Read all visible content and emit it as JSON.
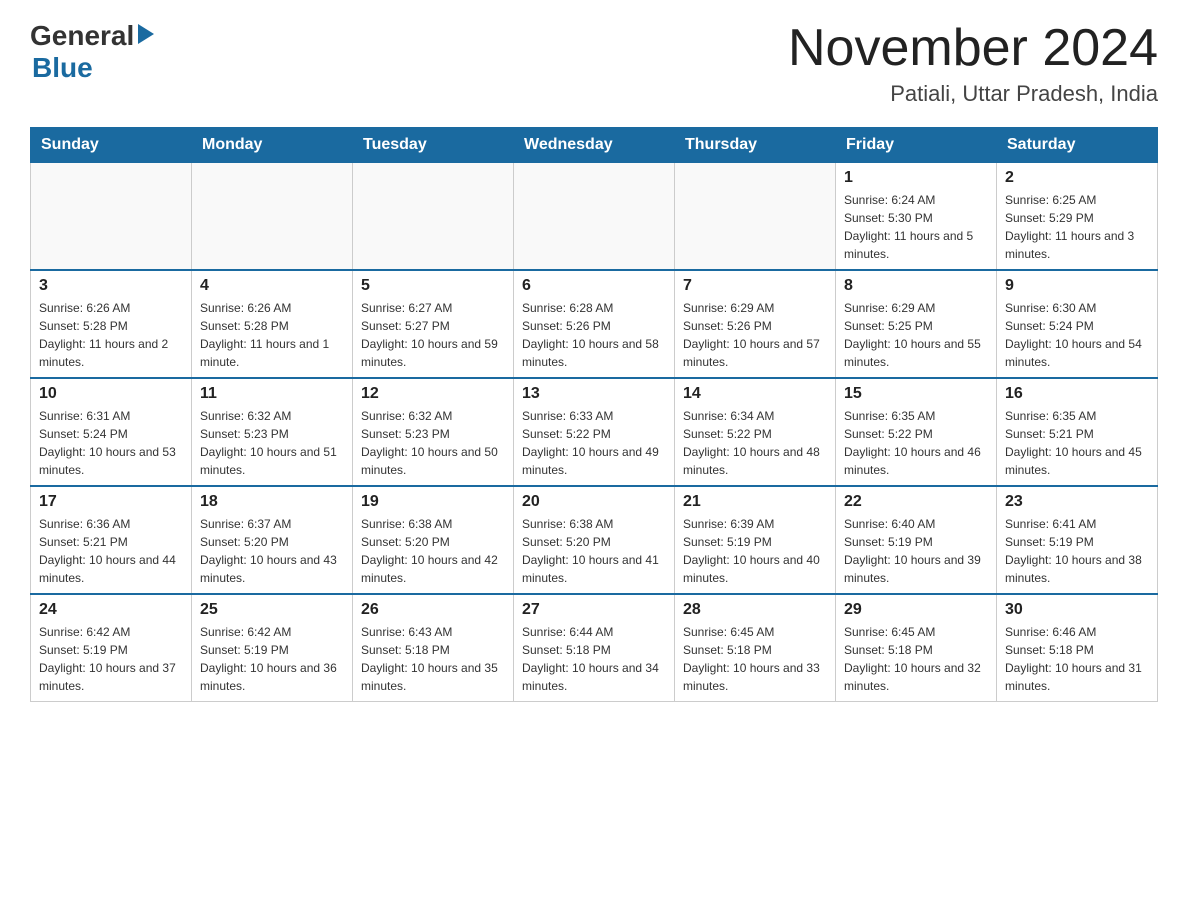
{
  "header": {
    "logo_general": "General",
    "logo_blue": "Blue",
    "month_title": "November 2024",
    "location": "Patiali, Uttar Pradesh, India"
  },
  "days_of_week": [
    "Sunday",
    "Monday",
    "Tuesday",
    "Wednesday",
    "Thursday",
    "Friday",
    "Saturday"
  ],
  "weeks": [
    [
      {
        "day": "",
        "sunrise": "",
        "sunset": "",
        "daylight": ""
      },
      {
        "day": "",
        "sunrise": "",
        "sunset": "",
        "daylight": ""
      },
      {
        "day": "",
        "sunrise": "",
        "sunset": "",
        "daylight": ""
      },
      {
        "day": "",
        "sunrise": "",
        "sunset": "",
        "daylight": ""
      },
      {
        "day": "",
        "sunrise": "",
        "sunset": "",
        "daylight": ""
      },
      {
        "day": "1",
        "sunrise": "Sunrise: 6:24 AM",
        "sunset": "Sunset: 5:30 PM",
        "daylight": "Daylight: 11 hours and 5 minutes."
      },
      {
        "day": "2",
        "sunrise": "Sunrise: 6:25 AM",
        "sunset": "Sunset: 5:29 PM",
        "daylight": "Daylight: 11 hours and 3 minutes."
      }
    ],
    [
      {
        "day": "3",
        "sunrise": "Sunrise: 6:26 AM",
        "sunset": "Sunset: 5:28 PM",
        "daylight": "Daylight: 11 hours and 2 minutes."
      },
      {
        "day": "4",
        "sunrise": "Sunrise: 6:26 AM",
        "sunset": "Sunset: 5:28 PM",
        "daylight": "Daylight: 11 hours and 1 minute."
      },
      {
        "day": "5",
        "sunrise": "Sunrise: 6:27 AM",
        "sunset": "Sunset: 5:27 PM",
        "daylight": "Daylight: 10 hours and 59 minutes."
      },
      {
        "day": "6",
        "sunrise": "Sunrise: 6:28 AM",
        "sunset": "Sunset: 5:26 PM",
        "daylight": "Daylight: 10 hours and 58 minutes."
      },
      {
        "day": "7",
        "sunrise": "Sunrise: 6:29 AM",
        "sunset": "Sunset: 5:26 PM",
        "daylight": "Daylight: 10 hours and 57 minutes."
      },
      {
        "day": "8",
        "sunrise": "Sunrise: 6:29 AM",
        "sunset": "Sunset: 5:25 PM",
        "daylight": "Daylight: 10 hours and 55 minutes."
      },
      {
        "day": "9",
        "sunrise": "Sunrise: 6:30 AM",
        "sunset": "Sunset: 5:24 PM",
        "daylight": "Daylight: 10 hours and 54 minutes."
      }
    ],
    [
      {
        "day": "10",
        "sunrise": "Sunrise: 6:31 AM",
        "sunset": "Sunset: 5:24 PM",
        "daylight": "Daylight: 10 hours and 53 minutes."
      },
      {
        "day": "11",
        "sunrise": "Sunrise: 6:32 AM",
        "sunset": "Sunset: 5:23 PM",
        "daylight": "Daylight: 10 hours and 51 minutes."
      },
      {
        "day": "12",
        "sunrise": "Sunrise: 6:32 AM",
        "sunset": "Sunset: 5:23 PM",
        "daylight": "Daylight: 10 hours and 50 minutes."
      },
      {
        "day": "13",
        "sunrise": "Sunrise: 6:33 AM",
        "sunset": "Sunset: 5:22 PM",
        "daylight": "Daylight: 10 hours and 49 minutes."
      },
      {
        "day": "14",
        "sunrise": "Sunrise: 6:34 AM",
        "sunset": "Sunset: 5:22 PM",
        "daylight": "Daylight: 10 hours and 48 minutes."
      },
      {
        "day": "15",
        "sunrise": "Sunrise: 6:35 AM",
        "sunset": "Sunset: 5:22 PM",
        "daylight": "Daylight: 10 hours and 46 minutes."
      },
      {
        "day": "16",
        "sunrise": "Sunrise: 6:35 AM",
        "sunset": "Sunset: 5:21 PM",
        "daylight": "Daylight: 10 hours and 45 minutes."
      }
    ],
    [
      {
        "day": "17",
        "sunrise": "Sunrise: 6:36 AM",
        "sunset": "Sunset: 5:21 PM",
        "daylight": "Daylight: 10 hours and 44 minutes."
      },
      {
        "day": "18",
        "sunrise": "Sunrise: 6:37 AM",
        "sunset": "Sunset: 5:20 PM",
        "daylight": "Daylight: 10 hours and 43 minutes."
      },
      {
        "day": "19",
        "sunrise": "Sunrise: 6:38 AM",
        "sunset": "Sunset: 5:20 PM",
        "daylight": "Daylight: 10 hours and 42 minutes."
      },
      {
        "day": "20",
        "sunrise": "Sunrise: 6:38 AM",
        "sunset": "Sunset: 5:20 PM",
        "daylight": "Daylight: 10 hours and 41 minutes."
      },
      {
        "day": "21",
        "sunrise": "Sunrise: 6:39 AM",
        "sunset": "Sunset: 5:19 PM",
        "daylight": "Daylight: 10 hours and 40 minutes."
      },
      {
        "day": "22",
        "sunrise": "Sunrise: 6:40 AM",
        "sunset": "Sunset: 5:19 PM",
        "daylight": "Daylight: 10 hours and 39 minutes."
      },
      {
        "day": "23",
        "sunrise": "Sunrise: 6:41 AM",
        "sunset": "Sunset: 5:19 PM",
        "daylight": "Daylight: 10 hours and 38 minutes."
      }
    ],
    [
      {
        "day": "24",
        "sunrise": "Sunrise: 6:42 AM",
        "sunset": "Sunset: 5:19 PM",
        "daylight": "Daylight: 10 hours and 37 minutes."
      },
      {
        "day": "25",
        "sunrise": "Sunrise: 6:42 AM",
        "sunset": "Sunset: 5:19 PM",
        "daylight": "Daylight: 10 hours and 36 minutes."
      },
      {
        "day": "26",
        "sunrise": "Sunrise: 6:43 AM",
        "sunset": "Sunset: 5:18 PM",
        "daylight": "Daylight: 10 hours and 35 minutes."
      },
      {
        "day": "27",
        "sunrise": "Sunrise: 6:44 AM",
        "sunset": "Sunset: 5:18 PM",
        "daylight": "Daylight: 10 hours and 34 minutes."
      },
      {
        "day": "28",
        "sunrise": "Sunrise: 6:45 AM",
        "sunset": "Sunset: 5:18 PM",
        "daylight": "Daylight: 10 hours and 33 minutes."
      },
      {
        "day": "29",
        "sunrise": "Sunrise: 6:45 AM",
        "sunset": "Sunset: 5:18 PM",
        "daylight": "Daylight: 10 hours and 32 minutes."
      },
      {
        "day": "30",
        "sunrise": "Sunrise: 6:46 AM",
        "sunset": "Sunset: 5:18 PM",
        "daylight": "Daylight: 10 hours and 31 minutes."
      }
    ]
  ]
}
